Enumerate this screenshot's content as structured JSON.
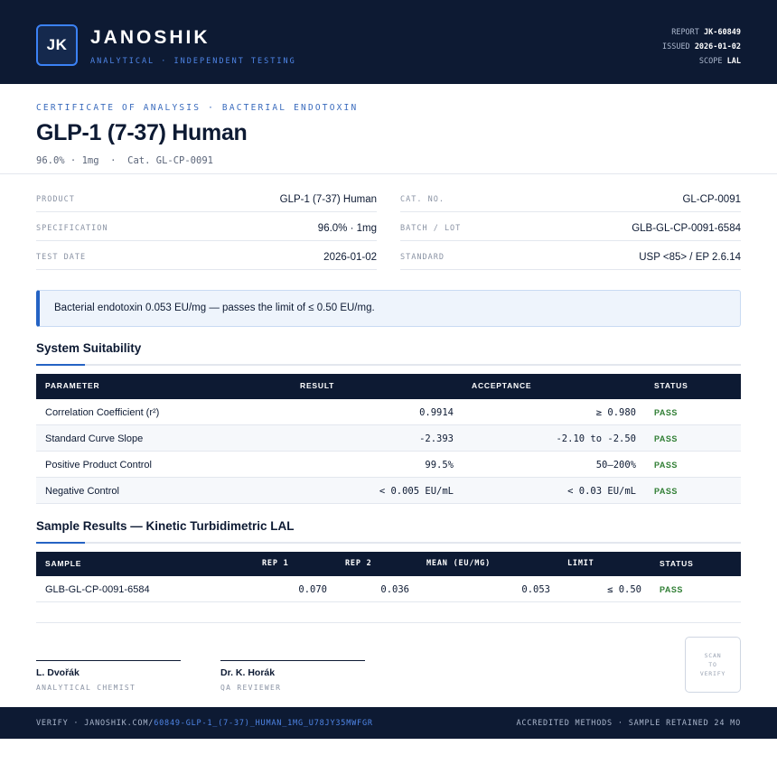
{
  "header": {
    "logo_initials": "JK",
    "brand": "JANOSHIK",
    "tagline": "ANALYTICAL · INDEPENDENT TESTING",
    "report_label": "REPORT",
    "report_value": "JK-60849",
    "issued_label": "ISSUED",
    "issued_value": "2026-01-02",
    "scope_label": "SCOPE",
    "scope_value": "LAL"
  },
  "title_block": {
    "kicker": "CERTIFICATE OF ANALYSIS · BACTERIAL ENDOTOXIN",
    "title": "GLP-1 (7-37) Human",
    "subline": "96.0% · 1mg  ·  Cat. GL-CP-0091"
  },
  "info": {
    "left": [
      {
        "label": "PRODUCT",
        "value": "GLP-1 (7-37) Human"
      },
      {
        "label": "SPECIFICATION",
        "value": "96.0% · 1mg"
      },
      {
        "label": "TEST DATE",
        "value": "2026-01-02"
      }
    ],
    "right": [
      {
        "label": "CAT. NO.",
        "value": "GL-CP-0091"
      },
      {
        "label": "BATCH / LOT",
        "value": "GLB-GL-CP-0091-6584"
      },
      {
        "label": "STANDARD",
        "value": "USP <85> / EP 2.6.14"
      }
    ]
  },
  "alert": {
    "text": "Bacterial endotoxin 0.053 EU/mg — passes the limit of ≤ 0.50 EU/mg."
  },
  "suitability": {
    "title": "System Suitability",
    "headers": {
      "parameter": "PARAMETER",
      "result": "RESULT",
      "acceptance": "ACCEPTANCE",
      "status": "STATUS"
    },
    "rows": [
      {
        "parameter": "Correlation Coefficient (r²)",
        "result": "0.9914",
        "acceptance": "≥ 0.980",
        "status": "PASS"
      },
      {
        "parameter": "Standard Curve Slope",
        "result": "-2.393",
        "acceptance": "-2.10 to -2.50",
        "status": "PASS"
      },
      {
        "parameter": "Positive Product Control",
        "result": "99.5%",
        "acceptance": "50–200%",
        "status": "PASS"
      },
      {
        "parameter": "Negative Control",
        "result": "< 0.005 EU/mL",
        "acceptance": "< 0.03 EU/mL",
        "status": "PASS"
      }
    ]
  },
  "samples": {
    "title": "Sample Results — Kinetic Turbidimetric LAL",
    "headers": {
      "sample": "SAMPLE",
      "rep1": "REP 1",
      "rep2": "REP 2",
      "mean": "MEAN (EU/MG)",
      "limit": "LIMIT",
      "status": "STATUS"
    },
    "rows": [
      {
        "sample": "GLB-GL-CP-0091-6584",
        "rep1": "0.070",
        "rep2": "0.036",
        "mean": "0.053",
        "limit": "≤ 0.50",
        "status": "PASS"
      }
    ]
  },
  "signatures": [
    {
      "name": "L. Dvořák",
      "role": "ANALYTICAL CHEMIST"
    },
    {
      "name": "Dr. K. Horák",
      "role": "QA REVIEWER"
    }
  ],
  "qr": {
    "line1": "SCAN",
    "line2": "TO",
    "line3": "VERIFY"
  },
  "footer": {
    "verify_prefix": "VERIFY · JANOSHIK.COM/",
    "verify_link": "60849-GLP-1_(7-37)_HUMAN_1MG_U78JY35MWFGR",
    "right": "ACCREDITED METHODS · SAMPLE RETAINED 24 MO"
  },
  "colors": {
    "navy": "#0d1a33",
    "accent_blue": "#2563c4",
    "pass_green": "#2e7d32"
  }
}
